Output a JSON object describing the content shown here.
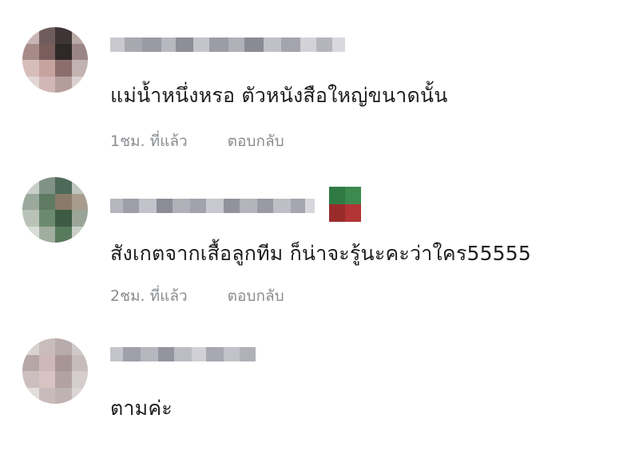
{
  "comments": [
    {
      "text": "แม่น้ำหนึ่งหรอ ตัวหนังสือใหญ่ขนาดนั้น",
      "time": "1ชม. ที่แล้ว",
      "reply": "ตอบกลับ"
    },
    {
      "text": "สังเกตจากเสื้อลูกทีม ก็น่าจะรู้นะคะว่าใคร55555",
      "time": "2ชม. ที่แล้ว",
      "reply": "ตอบกลับ"
    },
    {
      "text": "ตามค่ะ",
      "time": "",
      "reply": ""
    }
  ],
  "colors": {
    "text": "#1c1e21",
    "meta": "#8a8d91"
  },
  "icons": {
    "avatar": "pixelated-avatar-icon",
    "badge": "pixelated-badge-icon"
  }
}
